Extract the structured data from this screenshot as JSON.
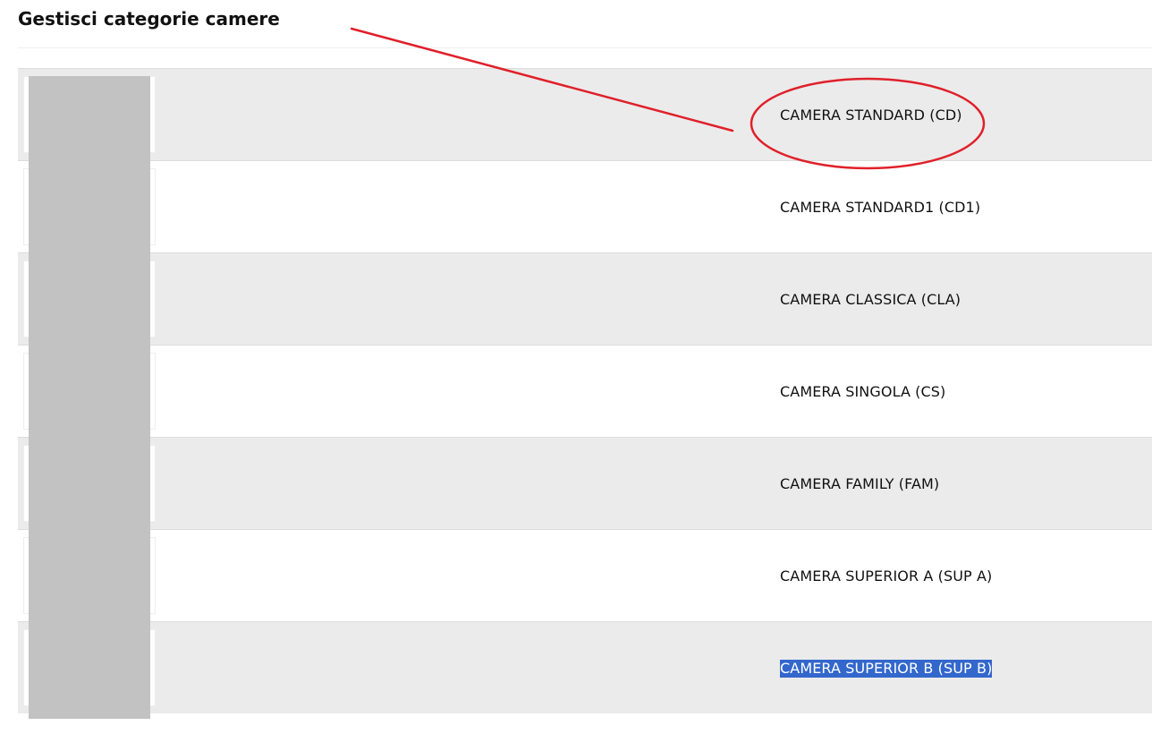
{
  "page": {
    "title": "Gestisci categorie camere"
  },
  "categories": [
    {
      "label": "CAMERA STANDARD (CD)"
    },
    {
      "label": "CAMERA STANDARD1 (CD1)"
    },
    {
      "label": "CAMERA CLASSICA (CLA)"
    },
    {
      "label": "CAMERA SINGOLA (CS)"
    },
    {
      "label": "CAMERA FAMILY (FAM)"
    },
    {
      "label": "CAMERA SUPERIOR A (SUP A)"
    },
    {
      "label": "CAMERA SUPERIOR B (SUP B)"
    }
  ],
  "colors": {
    "row_alt": "#ebebeb",
    "selection": "#3367cc",
    "annotation": "#e0202a",
    "redaction": "#c2c2c2"
  }
}
